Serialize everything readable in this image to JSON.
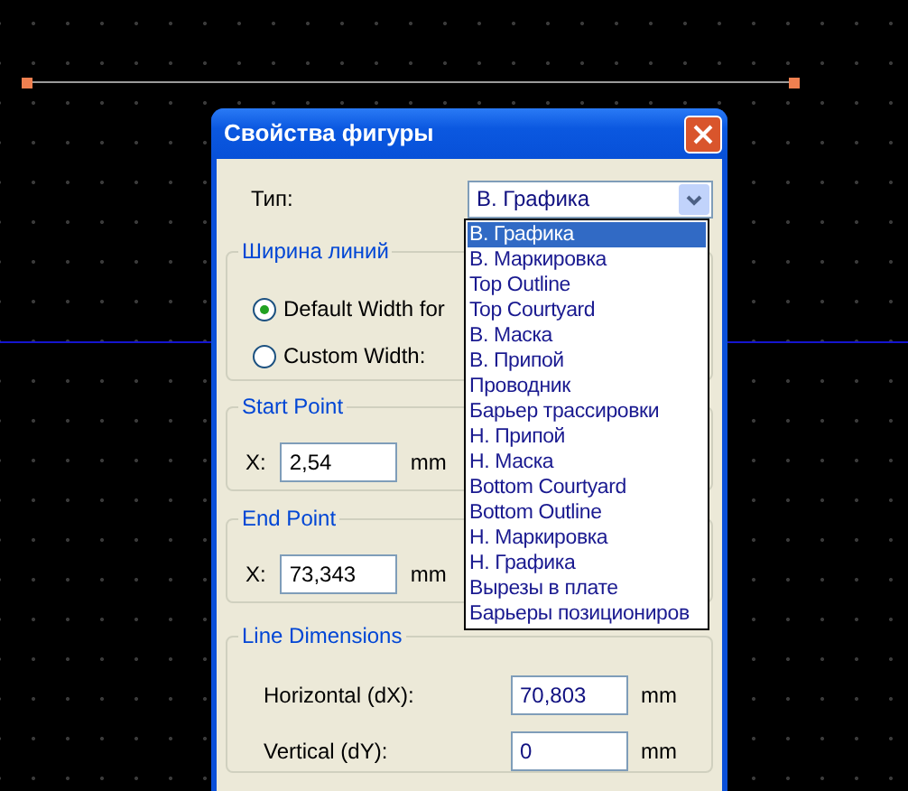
{
  "dialog": {
    "title": "Свойства фигуры",
    "type_field": {
      "label": "Тип:",
      "value": "В. Графика",
      "expanded": true,
      "options": [
        {
          "label": "В. Графика",
          "selected": true
        },
        {
          "label": "В. Маркировка",
          "selected": false
        },
        {
          "label": "Top Outline",
          "selected": false
        },
        {
          "label": "Top Courtyard",
          "selected": false
        },
        {
          "label": "В. Маска",
          "selected": false
        },
        {
          "label": "В. Припой",
          "selected": false
        },
        {
          "label": "Проводник",
          "selected": false
        },
        {
          "label": "Барьер трассировки",
          "selected": false
        },
        {
          "label": "Н. Припой",
          "selected": false
        },
        {
          "label": "Н. Маска",
          "selected": false
        },
        {
          "label": "Bottom Courtyard",
          "selected": false
        },
        {
          "label": "Bottom Outline",
          "selected": false
        },
        {
          "label": "Н. Маркировка",
          "selected": false
        },
        {
          "label": "Н. Графика",
          "selected": false
        },
        {
          "label": "Вырезы в плате",
          "selected": false
        },
        {
          "label": "Барьеры позициониров",
          "selected": false
        }
      ]
    },
    "line_width": {
      "legend": "Ширина линий",
      "options": [
        {
          "label": "Default Width for",
          "selected": true
        },
        {
          "label": "Custom Width:",
          "selected": false
        }
      ]
    },
    "start_point": {
      "legend": "Start Point",
      "x_label": "X:",
      "x_value": "2,54",
      "unit": "mm"
    },
    "end_point": {
      "legend": "End Point",
      "x_label": "X:",
      "x_value": "73,343",
      "unit": "mm"
    },
    "line_dimensions": {
      "legend": "Line Dimensions",
      "rows": [
        {
          "label": "Horizontal (dX):",
          "value": "70,803",
          "unit": "mm"
        },
        {
          "label": "Vertical (dY):",
          "value": "0",
          "unit": "mm"
        }
      ]
    }
  }
}
